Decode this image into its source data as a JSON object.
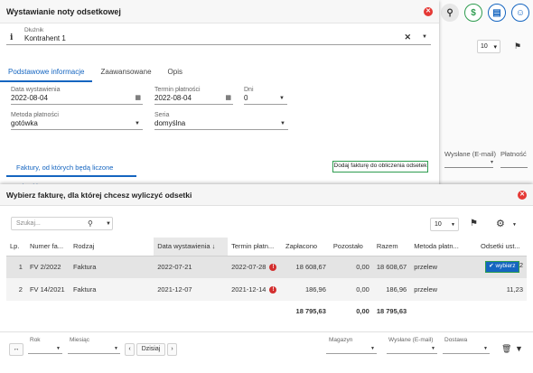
{
  "background": {
    "top_icons": [
      "search-icon",
      "dollar-icon",
      "book-icon",
      "user-icon"
    ],
    "page_size": "10",
    "columns": [
      {
        "label": "Wysłane (E-mail)"
      },
      {
        "label": "Płatność"
      }
    ]
  },
  "note_modal": {
    "title": "Wystawianie noty odsetkowej",
    "debtor": {
      "label": "Dłużnik",
      "value": "Kontrahent 1"
    },
    "tabs": [
      {
        "label": "Podstawowe informacje",
        "active": true
      },
      {
        "label": "Zaawansowane",
        "active": false
      },
      {
        "label": "Opis",
        "active": false
      }
    ],
    "issue_date": {
      "label": "Data wystawienia",
      "value": "2022-08-04"
    },
    "due_date": {
      "label": "Termin płatności",
      "value": "2022-08-04"
    },
    "days": {
      "label": "Dni",
      "value": "0"
    },
    "payment_method": {
      "label": "Metoda płatności",
      "value": "gotówka"
    },
    "series": {
      "label": "Seria",
      "value": "domyślna"
    },
    "invoices_tab": "Faktury, od których będą liczone odsetki",
    "add_invoice_button": "Dodaj fakturę do obliczenia odsetek"
  },
  "picker_modal": {
    "title": "Wybierz fakturę, dla której chcesz wyliczyć odsetki",
    "search_placeholder": "Szukaj...",
    "page_size": "10",
    "columns": [
      "Lp.",
      "Numer fa...",
      "Rodzaj",
      "Data wystawienia",
      "Termin płatn...",
      "Zapłacono",
      "Pozostało",
      "Razem",
      "Metoda płatn...",
      "Odsetki ust..."
    ],
    "sorted_column": "Data wystawienia",
    "rows": [
      {
        "lp": "1",
        "number": "FV 2/2022",
        "kind": "Faktura",
        "issue_date": "2022-07-21",
        "due_date": "2022-07-28",
        "paid": "18 608,67",
        "remaining": "0,00",
        "total": "18 608,67",
        "method": "przelew",
        "action": "wybierz",
        "interest": "2"
      },
      {
        "lp": "2",
        "number": "FV 14/2021",
        "kind": "Faktura",
        "issue_date": "2021-12-07",
        "due_date": "2021-12-14",
        "paid": "186,96",
        "remaining": "0,00",
        "total": "186,96",
        "method": "przelew",
        "action": "",
        "interest": "11,23"
      }
    ],
    "totals": {
      "paid": "18 795,63",
      "remaining": "0,00",
      "total": "18 795,63"
    },
    "footer": {
      "year_label": "Rok",
      "month_label": "Miesiąc",
      "today_label": "Dzisiaj",
      "magazyn_label": "Magazyn",
      "email_label": "Wysłane (E-mail)",
      "delivery_label": "Dostawa"
    },
    "accent_color": "#1565c0",
    "warning_color": "#d32f2f",
    "highlight_color": "#2e9c4f"
  }
}
